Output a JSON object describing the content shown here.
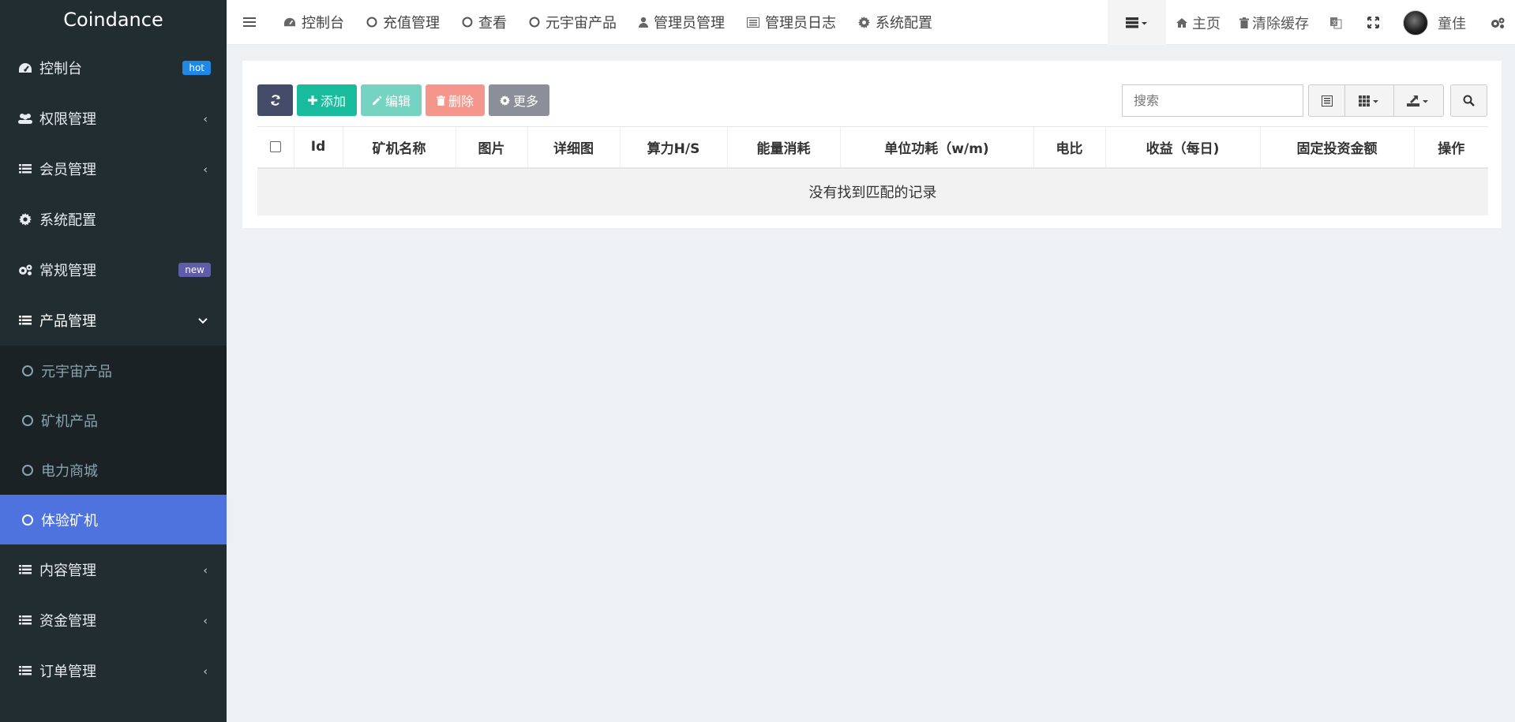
{
  "app": {
    "title": "Coindance"
  },
  "sidebar": {
    "items": [
      {
        "label": "控制台",
        "icon": "dashboard-icon",
        "badge": "hot"
      },
      {
        "label": "权限管理",
        "icon": "users-icon"
      },
      {
        "label": "会员管理",
        "icon": "list-icon"
      },
      {
        "label": "系统配置",
        "icon": "gear-icon"
      },
      {
        "label": "常规管理",
        "icon": "gears-icon",
        "badge": "new"
      },
      {
        "label": "产品管理",
        "icon": "list-icon"
      },
      {
        "label": "内容管理",
        "icon": "list-icon"
      },
      {
        "label": "资金管理",
        "icon": "list-icon"
      },
      {
        "label": "订单管理",
        "icon": "list-icon"
      }
    ],
    "product_submenu": [
      {
        "label": "元宇宙产品"
      },
      {
        "label": "矿机产品"
      },
      {
        "label": "电力商城"
      },
      {
        "label": "体验矿机",
        "active": true
      }
    ]
  },
  "topnav": {
    "tabs": [
      {
        "label": "控制台",
        "icon": "dashboard-icon"
      },
      {
        "label": "充值管理",
        "icon": "circle-icon"
      },
      {
        "label": "查看",
        "icon": "circle-icon"
      },
      {
        "label": "元宇宙产品",
        "icon": "circle-icon"
      },
      {
        "label": "管理员管理",
        "icon": "user-icon"
      },
      {
        "label": "管理员日志",
        "icon": "list-alt-icon"
      },
      {
        "label": "系统配置",
        "icon": "gear-icon"
      }
    ],
    "home": "主页",
    "clear_cache": "清除缓存",
    "username": "童佳"
  },
  "toolbar": {
    "add": "添加",
    "edit": "编辑",
    "delete": "删除",
    "more": "更多",
    "search_placeholder": "搜索"
  },
  "table": {
    "columns": [
      "Id",
      "矿机名称",
      "图片",
      "详细图",
      "算力H/S",
      "能量消耗",
      "单位功耗（w/m)",
      "电比",
      "收益（每日)",
      "固定投资金额",
      "操作"
    ],
    "empty_text": "没有找到匹配的记录"
  },
  "colors": {
    "sidebar_bg": "#222d32",
    "active_item": "#4e73df",
    "add_button": "#18bc9c",
    "delete_button": "#f5968c"
  }
}
